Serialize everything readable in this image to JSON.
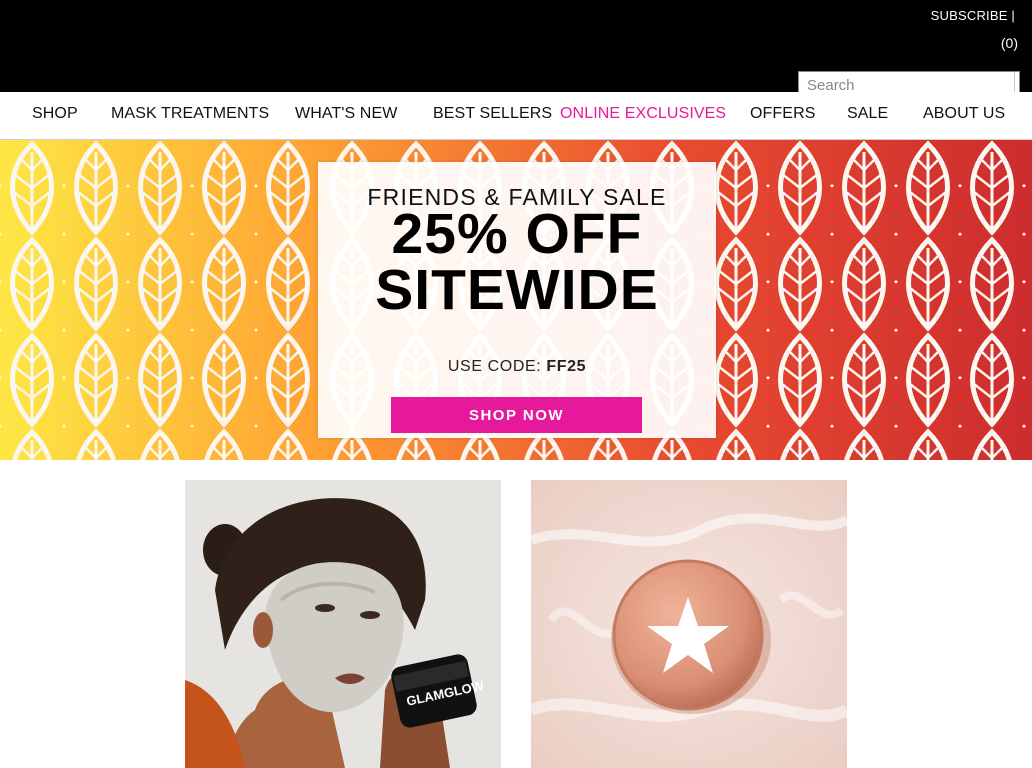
{
  "header": {
    "subscribe_label": "SUBSCRIBE |",
    "cart_label": "(0)",
    "search": {
      "placeholder": "Search",
      "value": ""
    }
  },
  "nav": {
    "items": [
      {
        "label": "SHOP"
      },
      {
        "label": "MASK TREATMENTS"
      },
      {
        "label": "WHAT'S NEW"
      },
      {
        "label": "BEST SELLERS"
      },
      {
        "label": "ONLINE EXCLUSIVES",
        "highlight": true
      },
      {
        "label": "OFFERS"
      },
      {
        "label": "SALE"
      },
      {
        "label": "ABOUT US"
      }
    ]
  },
  "hero": {
    "eyebrow": "FRIENDS & FAMILY SALE",
    "headline_line1": "25% OFF",
    "headline_line2": "SITEWIDE",
    "code_label": "USE CODE:",
    "code": "FF25",
    "cta_label": "SHOP NOW"
  },
  "products": [
    {
      "image": "model-with-clay-mask-holding-glamglow-jar"
    },
    {
      "image": "pink-compact-with-white-star-on-cream-texture"
    }
  ],
  "colors": {
    "accent": "#e6199b",
    "topbar": "#000000",
    "leaf_gradient": [
      "#ffe633",
      "#ff9a1f",
      "#e83a1c",
      "#c8171a"
    ]
  },
  "icons": {
    "search_button": "search-icon",
    "product_badge": "star-icon"
  }
}
